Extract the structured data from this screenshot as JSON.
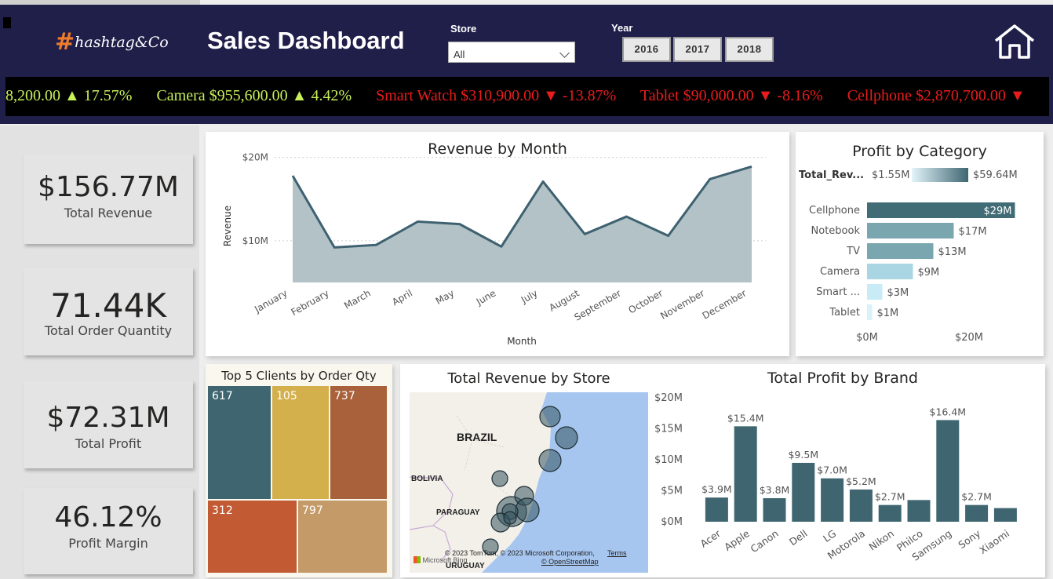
{
  "header": {
    "logo_text": "hashtag&Co",
    "logo_hash": "#",
    "title": "Sales Dashboard",
    "store_label": "Store",
    "store_value": "All",
    "year_label": "Year",
    "years": [
      "2016",
      "2017",
      "2018"
    ],
    "home_icon": "home-icon",
    "colors": {
      "banner": "#1f1f4a",
      "logo_hash": "#f07c2b"
    }
  },
  "ticker": {
    "items": [
      {
        "text": "8,200.00",
        "arrow": "▲",
        "pct": "17.57%",
        "dir": "up"
      },
      {
        "text": "Camera $955,600.00",
        "arrow": "▲",
        "pct": "4.42%",
        "dir": "up"
      },
      {
        "text": "Smart Watch $310,900.00",
        "arrow": "▼",
        "pct": "-13.87%",
        "dir": "down"
      },
      {
        "text": "Tablet $90,000.00",
        "arrow": "▼",
        "pct": "-8.16%",
        "dir": "down"
      },
      {
        "text": "Cellphone $2,870,700.00",
        "arrow": "▼",
        "pct": "",
        "dir": "down"
      }
    ],
    "colors": {
      "up": "#c8f05a",
      "down": "#e81c1c"
    }
  },
  "kpis": [
    {
      "value": "$156.77M",
      "label": "Total Revenue"
    },
    {
      "value": "71.44K",
      "label": "Total Order Quantity"
    },
    {
      "value": "$72.31M",
      "label": "Total Profit"
    },
    {
      "value": "46.12%",
      "label": "Profit Margin"
    }
  ],
  "chart_data": [
    {
      "type": "area",
      "title": "Revenue by Month",
      "xlabel": "Month",
      "ylabel": "Revenue",
      "categories": [
        "January",
        "February",
        "March",
        "April",
        "May",
        "June",
        "July",
        "August",
        "September",
        "October",
        "November",
        "December"
      ],
      "values": [
        17.8,
        9.2,
        9.5,
        12.3,
        12.0,
        9.3,
        17.1,
        10.8,
        12.9,
        10.6,
        17.4,
        18.9
      ],
      "yticks": [
        {
          "value": 10,
          "label": "$10M"
        },
        {
          "value": 20,
          "label": "$20M"
        }
      ],
      "ylim": [
        5,
        21
      ],
      "grid": true,
      "colors": {
        "line": "#3e6170",
        "fill": "#b2c2c7"
      }
    },
    {
      "type": "bar",
      "orientation": "horizontal",
      "title": "Profit by Category",
      "legend": {
        "field": "Total_Rev...",
        "min_label": "$1.55M",
        "max_label": "$59.64M"
      },
      "categories": [
        "Cellphone",
        "Notebook",
        "TV",
        "Camera",
        "Smart ...",
        "Tablet"
      ],
      "values": [
        29,
        17,
        13,
        9,
        3,
        1
      ],
      "data_labels": [
        "$29M",
        "$17M",
        "$13M",
        "$9M",
        "$3M",
        "$1M"
      ],
      "colors": [
        "#426c75",
        "#7aa6b0",
        "#7aa6b0",
        "#a9d6e2",
        "#c8ebf5",
        "#d9f1f8"
      ],
      "xticks": [
        {
          "value": 0,
          "label": "$0M"
        },
        {
          "value": 20,
          "label": "$20M"
        }
      ],
      "xlim": [
        0,
        30
      ]
    },
    {
      "type": "treemap",
      "title": "Top 5 Clients by Order Qty",
      "values": [
        617,
        105,
        737,
        312,
        797
      ],
      "colors": [
        "#3f6670",
        "#d4b04c",
        "#a8613a",
        "#c25a34",
        "#c49a68"
      ]
    },
    {
      "type": "map",
      "title": "Total Revenue by Store",
      "labels": [
        "BRAZIL",
        "BOLIVIA",
        "PARAGUAY",
        "URUGUAY"
      ],
      "attribution": "© 2023 TomTom, © 2023 Microsoft Corporation,",
      "terms": "Terms",
      "osm": "© OpenStreetMap",
      "bing": "Microsoft Bing"
    },
    {
      "type": "bar",
      "title": "Total Profit by Brand",
      "categories": [
        "Acer",
        "Apple",
        "Canon",
        "Dell",
        "LG",
        "Motorola",
        "Nikon",
        "Philco",
        "Samsung",
        "Sony",
        "Xiaomi"
      ],
      "values": [
        3.9,
        15.4,
        3.8,
        9.5,
        7.0,
        5.2,
        2.7,
        3.5,
        16.4,
        2.7,
        2.2
      ],
      "data_labels": [
        "$3.9M",
        "$15.4M",
        "$3.8M",
        "$9.5M",
        "$7.0M",
        "$5.2M",
        "$2.7M",
        "",
        "$16.4M",
        "$2.7M",
        ""
      ],
      "yticks": [
        {
          "value": 0,
          "label": "$0M"
        },
        {
          "value": 5,
          "label": "$5M"
        },
        {
          "value": 10,
          "label": "$10M"
        },
        {
          "value": 15,
          "label": "$15M"
        },
        {
          "value": 20,
          "label": "$20M"
        }
      ],
      "ylim": [
        0,
        20
      ],
      "color": "#3f6670"
    }
  ]
}
